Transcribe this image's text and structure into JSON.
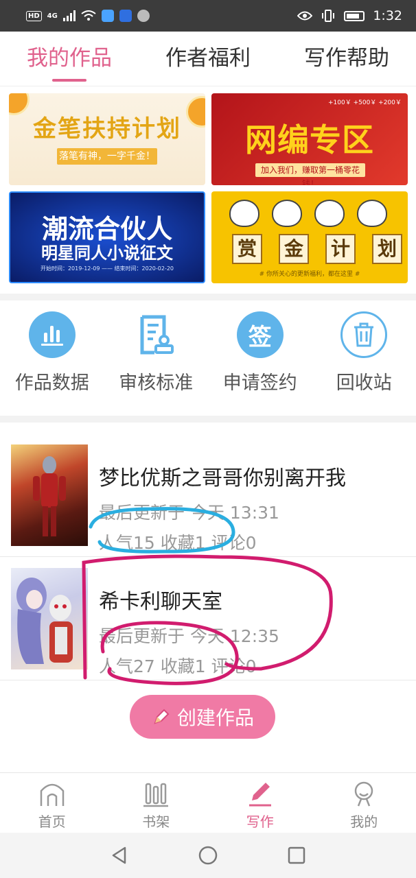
{
  "status_bar": {
    "left_badge": "HD",
    "network": "4G",
    "time": "1:32"
  },
  "tabs": [
    {
      "label": "我的作品",
      "active": true
    },
    {
      "label": "作者福利",
      "active": false
    },
    {
      "label": "写作帮助",
      "active": false
    }
  ],
  "banners": {
    "b1": {
      "title": "金笔扶持计划",
      "subtitle": "落笔有神，一字千金！"
    },
    "b2": {
      "title": "网编专区",
      "subtitle": "加入我们，赚取第一桶零花钱！",
      "prices": "+100￥ +500￥ +200￥"
    },
    "b3": {
      "title": "潮流合伙人",
      "subtitle": "明星同人小说征文",
      "dates": "开始时间：2019-12-09 —— 结束时间：2020-02-20"
    },
    "b4": {
      "chars": [
        "赏",
        "金",
        "计",
        "划"
      ],
      "note": "# 你所关心的更新福利，都在这里 #"
    }
  },
  "tools": [
    {
      "label": "作品数据",
      "icon": "bar-chart-icon",
      "color": "#5fb4ea"
    },
    {
      "label": "审核标准",
      "icon": "document-stamp-icon",
      "color": "#5fb4ea"
    },
    {
      "label": "申请签约",
      "icon": "sign-icon",
      "color": "#5fb4ea"
    },
    {
      "label": "回收站",
      "icon": "trash-icon",
      "color": "#5fb4ea"
    }
  ],
  "works": [
    {
      "title": "梦比优斯之哥哥你别离开我",
      "updated": "最后更新于  今天  13:31",
      "stats": "人气15  收藏1  评论0"
    },
    {
      "title": "希卡利聊天室",
      "updated": "最后更新于  今天  12:35",
      "stats": "人气27  收藏1  评论0"
    }
  ],
  "create_button": {
    "label": "创建作品"
  },
  "bottom_nav": [
    {
      "label": "首页",
      "icon": "home-icon",
      "active": false
    },
    {
      "label": "书架",
      "icon": "bookshelf-icon",
      "active": false
    },
    {
      "label": "写作",
      "icon": "pen-icon",
      "active": true
    },
    {
      "label": "我的",
      "icon": "profile-icon",
      "active": false
    }
  ],
  "colors": {
    "accent": "#e0628d",
    "tool_blue": "#5fb4ea",
    "create_pink": "#f07aa5"
  }
}
